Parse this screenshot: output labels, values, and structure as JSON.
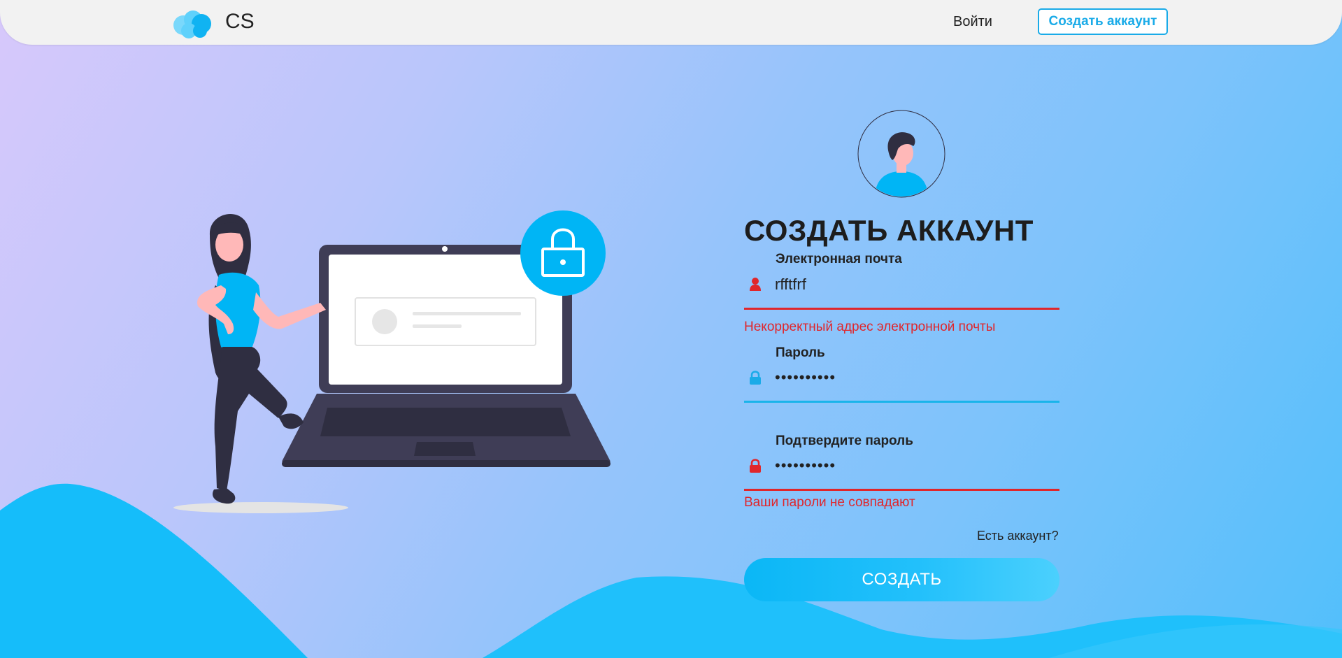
{
  "nav": {
    "brand": "CS",
    "login_label": "Войти",
    "create_account_label": "Создать аккаунт"
  },
  "form": {
    "title": "СОЗДАТЬ АККАУНТ",
    "email": {
      "label": "Электронная почта",
      "value": "rfftfrf",
      "error": "Некорректный адрес электронной почты"
    },
    "password": {
      "label": "Пароль",
      "value": "••••••••••"
    },
    "confirm_password": {
      "label": "Подтвердите пароль",
      "value": "••••••••••",
      "error": "Ваши пароли не совпадают"
    },
    "have_account_link": "Есть аккаунт?",
    "submit_label": "СОЗДАТЬ"
  },
  "colors": {
    "accent": "#1aabe8",
    "error": "#e0262b",
    "navbar_bg": "#f2f2f2"
  },
  "icons": {
    "logo": "cloud-logo-icon",
    "email_field": "user-icon",
    "password_field": "lock-icon",
    "confirm_field": "lock-icon",
    "illustration_lock": "padlock-icon"
  }
}
